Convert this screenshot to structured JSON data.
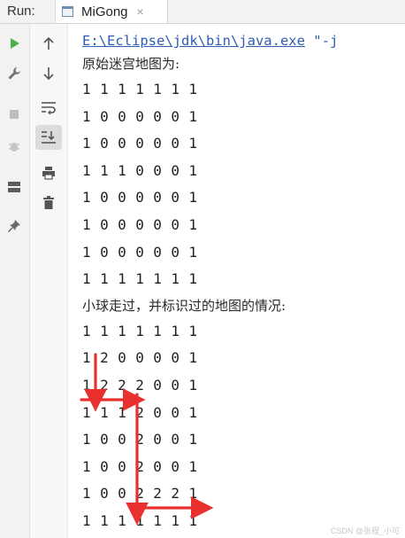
{
  "toolwindow": {
    "run_label": "Run:",
    "tab_label": "MiGong",
    "tab_close": "×"
  },
  "toolbar": {
    "left_icons": [
      "run-icon",
      "wrench-icon",
      "stop-icon",
      "debug-icon",
      "layout-icon",
      "pin-icon"
    ],
    "right_icons": [
      "arrow-up-icon",
      "arrow-down-icon",
      "soft-wrap-icon",
      "scroll-to-end-icon",
      "print-icon",
      "trash-icon"
    ]
  },
  "console": {
    "command_path": "E:\\Eclipse\\jdk\\bin\\java.exe",
    "command_rest": " \"-j",
    "header_original": "原始迷宫地图为:",
    "original_rows": [
      "1 1 1 1 1 1 1",
      "1 0 0 0 0 0 1",
      "1 0 0 0 0 0 1",
      "1 1 1 0 0 0 1",
      "1 0 0 0 0 0 1",
      "1 0 0 0 0 0 1",
      "1 0 0 0 0 0 1",
      "1 1 1 1 1 1 1"
    ],
    "header_path": "小球走过，并标识过的地图的情况:",
    "path_rows": [
      "1 1 1 1 1 1 1",
      "1 2 0 0 0 0 1",
      "1 2 2 2 0 0 1",
      "1 1 1 2 0 0 1",
      "1 0 0 2 0 0 1",
      "1 0 0 2 0 0 1",
      "1 0 0 2 2 2 1",
      "1 1 1 1 1 1 1"
    ]
  },
  "colors": {
    "accent_run": "#4caf50",
    "path_blue": "#2f5db3",
    "arrow_red": "#e8312f"
  },
  "watermark": "CSDN @张程_小可"
}
